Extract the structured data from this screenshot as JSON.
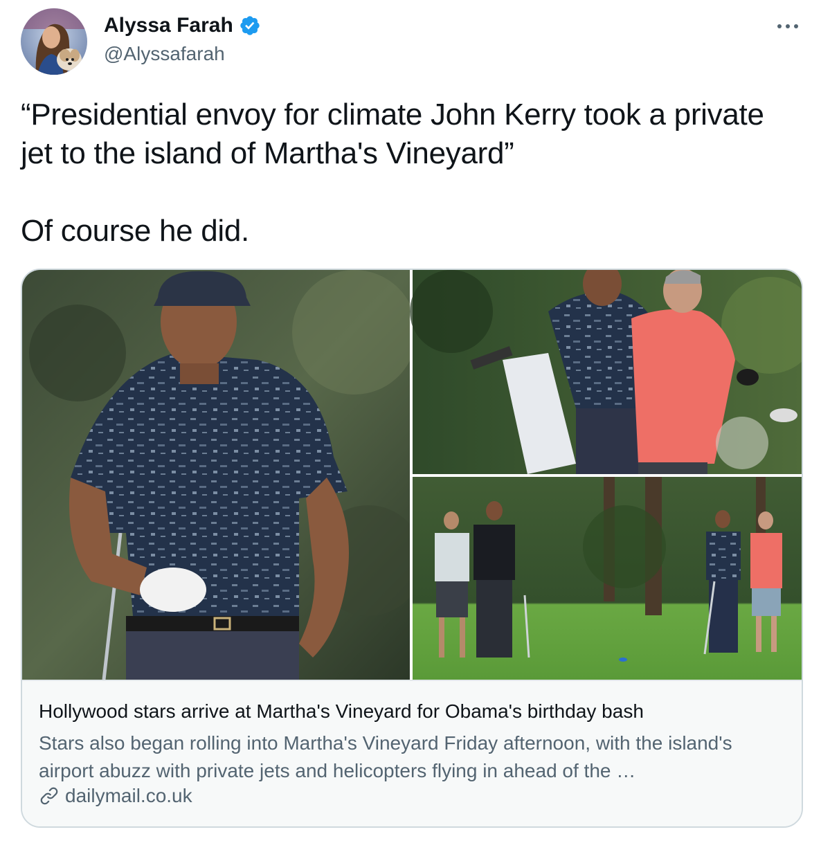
{
  "author": {
    "display_name": "Alyssa Farah",
    "handle": "@Alyssafarah",
    "verified": true,
    "avatar_icon": "profile-photo-with-dog"
  },
  "more_icon": "more-horizontal-icon",
  "tweet": {
    "line1": "“Presidential envoy for climate John Kerry took a private jet to the island of Martha's Vineyard”",
    "line2": "Of course he did."
  },
  "card": {
    "title": "Hollywood stars arrive at Martha's Vineyard for Obama's birthday bash",
    "description": "Stars also began rolling into Martha's Vineyard Friday afternoon, with the island's airport abuzz with private jets and helicopters flying in ahead of the …",
    "domain": "dailymail.co.uk",
    "link_icon": "link-icon"
  },
  "colors": {
    "text_primary": "#0f1419",
    "text_secondary": "#536471",
    "verified_blue": "#1d9bf0",
    "card_border": "#cfd9de",
    "card_info_bg": "#f7f9f9"
  }
}
